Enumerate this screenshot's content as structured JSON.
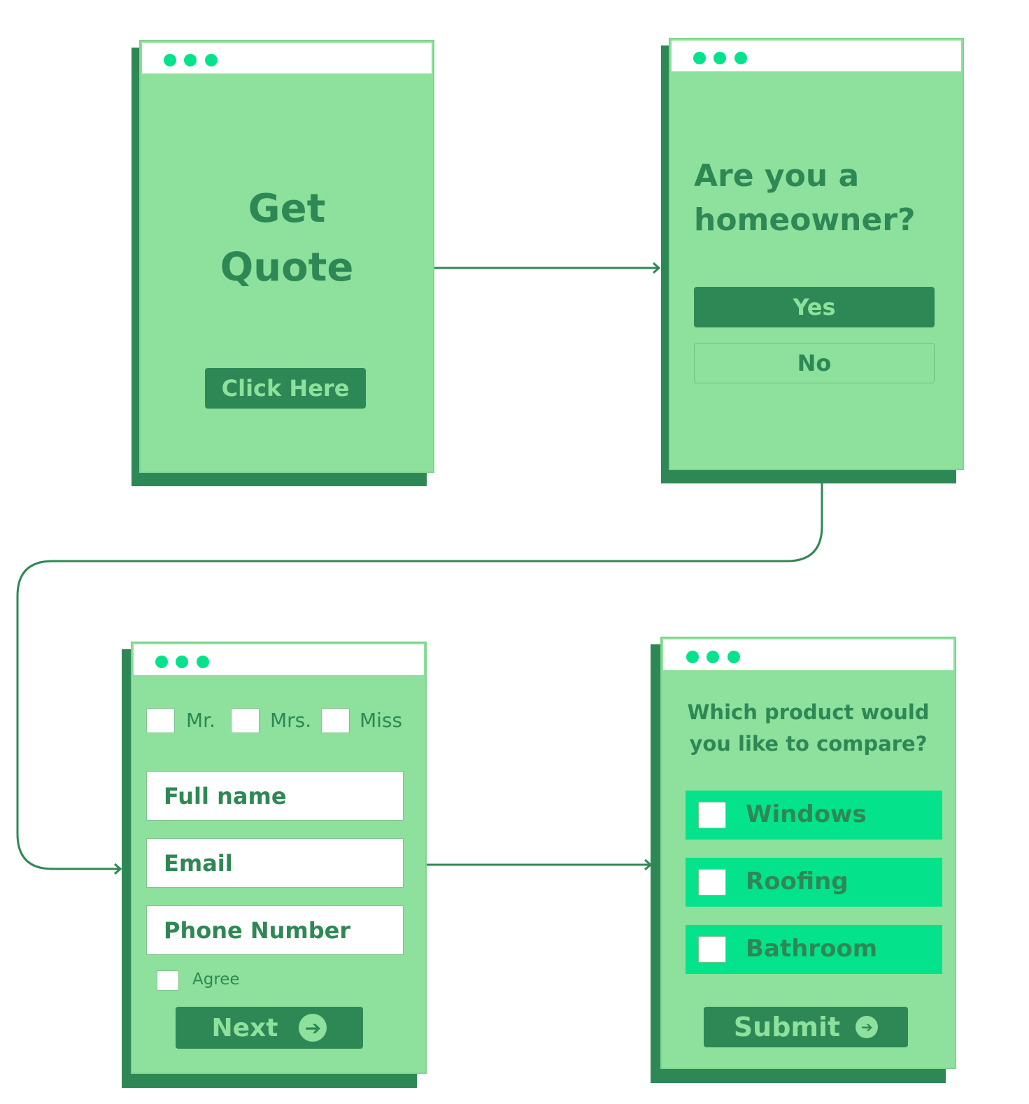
{
  "colors": {
    "card": "#8DE19C",
    "dark": "#2E8855",
    "accent": "#04E38C"
  },
  "screen1": {
    "title_line1": "Get",
    "title_line2": "Quote",
    "button": "Click Here"
  },
  "screen2": {
    "question_line1": "Are you a",
    "question_line2": "homeowner?",
    "yes": "Yes",
    "no": "No"
  },
  "screen3": {
    "titles": [
      "Mr.",
      "Mrs.",
      "Miss"
    ],
    "fields": [
      "Full name",
      "Email",
      "Phone Number"
    ],
    "agree": "Agree",
    "next": "Next",
    "next_icon": "arrow-right-circle-icon"
  },
  "screen4": {
    "question_line1": "Which product would",
    "question_line2": "you like to compare?",
    "options": [
      "Windows",
      "Roofing",
      "Bathroom"
    ],
    "submit": "Submit",
    "submit_icon": "arrow-right-circle-icon"
  }
}
